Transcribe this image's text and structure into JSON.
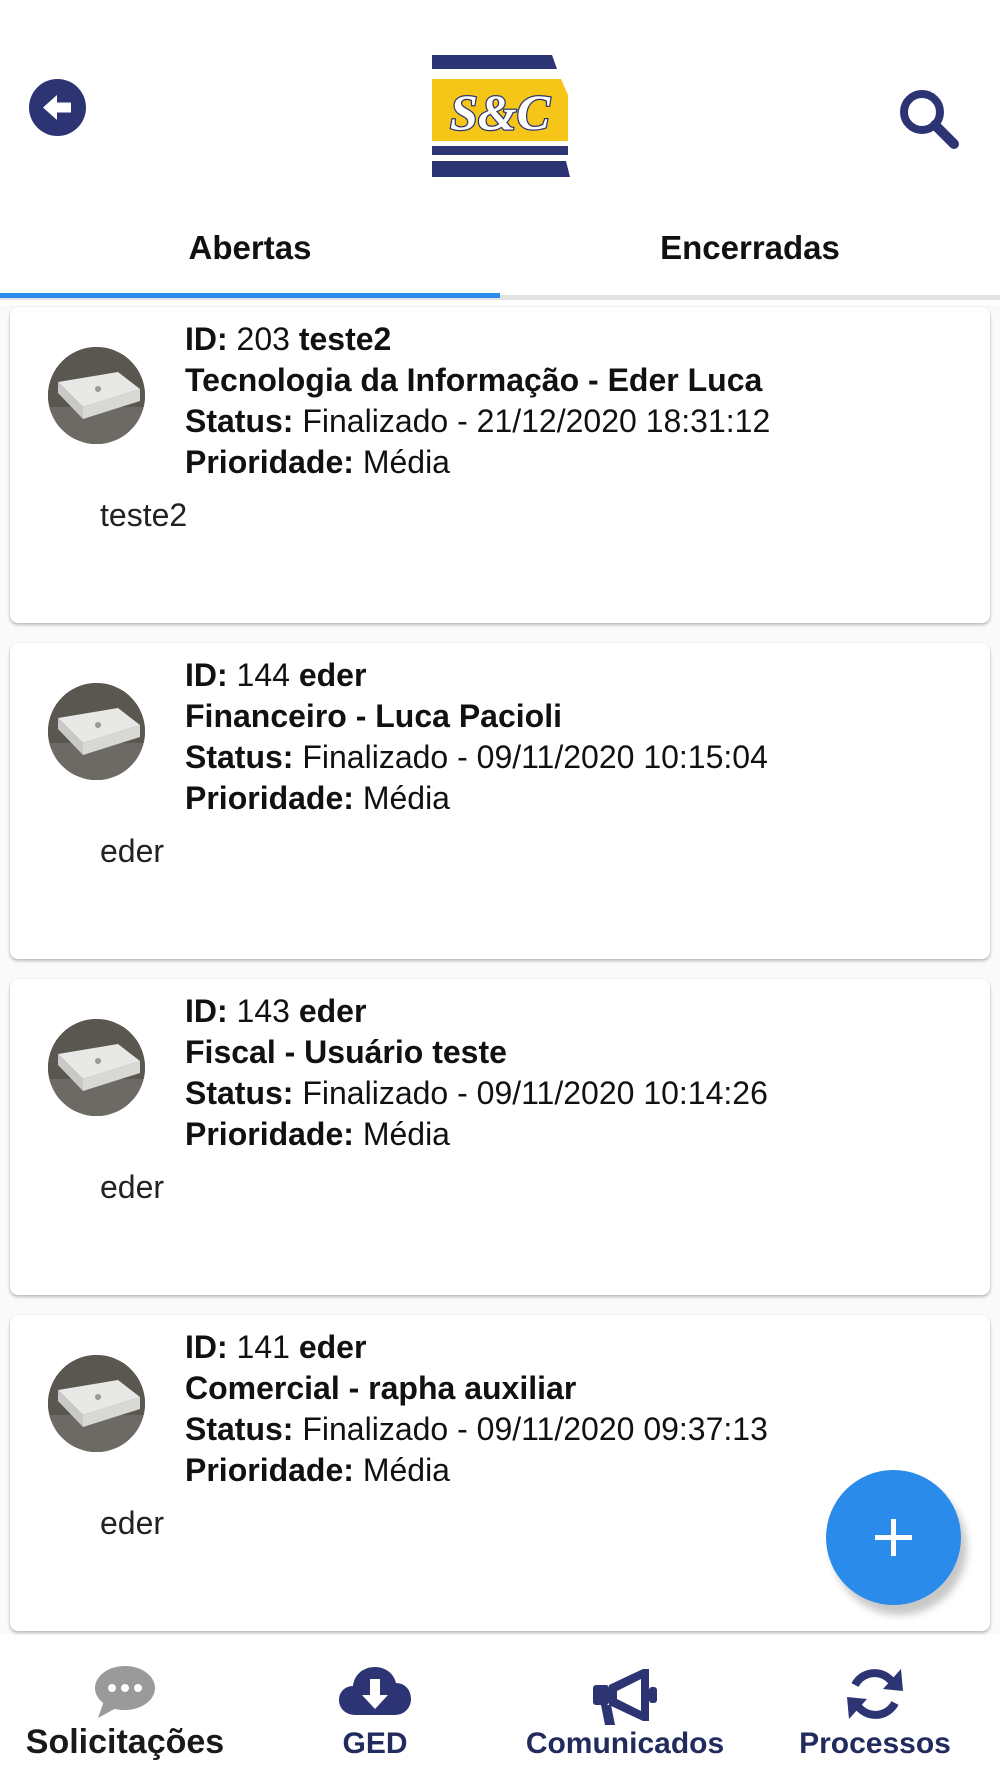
{
  "header": {
    "logo_text": "S&C",
    "colors": {
      "navy": "#2c3474",
      "yellow": "#f5c518"
    },
    "icons": {
      "back": "arrow-left-circle-icon",
      "search": "search-icon"
    }
  },
  "tabs": [
    {
      "label": "Abertas",
      "active": true
    },
    {
      "label": "Encerradas",
      "active": false
    }
  ],
  "requests": [
    {
      "id_label": "ID:",
      "id": "203",
      "user": "teste2",
      "department_user": "Tecnologia da Informação - Eder Luca",
      "status_label": "Status:",
      "status": "Finalizado - 21/12/2020 18:31:12",
      "priority_label": "Prioridade:",
      "priority": "Média",
      "description": "teste2"
    },
    {
      "id_label": "ID:",
      "id": "144",
      "user": "eder",
      "department_user": "Financeiro - Luca Pacioli",
      "status_label": "Status:",
      "status": "Finalizado - 09/11/2020 10:15:04",
      "priority_label": "Prioridade:",
      "priority": "Média",
      "description": "eder"
    },
    {
      "id_label": "ID:",
      "id": "143",
      "user": "eder",
      "department_user": "Fiscal - Usuário teste",
      "status_label": "Status:",
      "status": "Finalizado - 09/11/2020 10:14:26",
      "priority_label": "Prioridade:",
      "priority": "Média",
      "description": "eder"
    },
    {
      "id_label": "ID:",
      "id": "141",
      "user": "eder",
      "department_user": "Comercial - rapha auxiliar",
      "status_label": "Status:",
      "status": "Finalizado - 09/11/2020 09:37:13",
      "priority_label": "Prioridade:",
      "priority": "Média",
      "description": "eder"
    }
  ],
  "fab": {
    "icon": "plus-icon",
    "color": "#2b8bea"
  },
  "bottom_nav": [
    {
      "label": "Solicitações",
      "icon": "chat-bubble-icon",
      "active": true
    },
    {
      "label": "GED",
      "icon": "cloud-download-icon",
      "active": false
    },
    {
      "label": "Comunicados",
      "icon": "megaphone-icon",
      "active": false
    },
    {
      "label": "Processos",
      "icon": "sync-icon",
      "active": false
    }
  ]
}
